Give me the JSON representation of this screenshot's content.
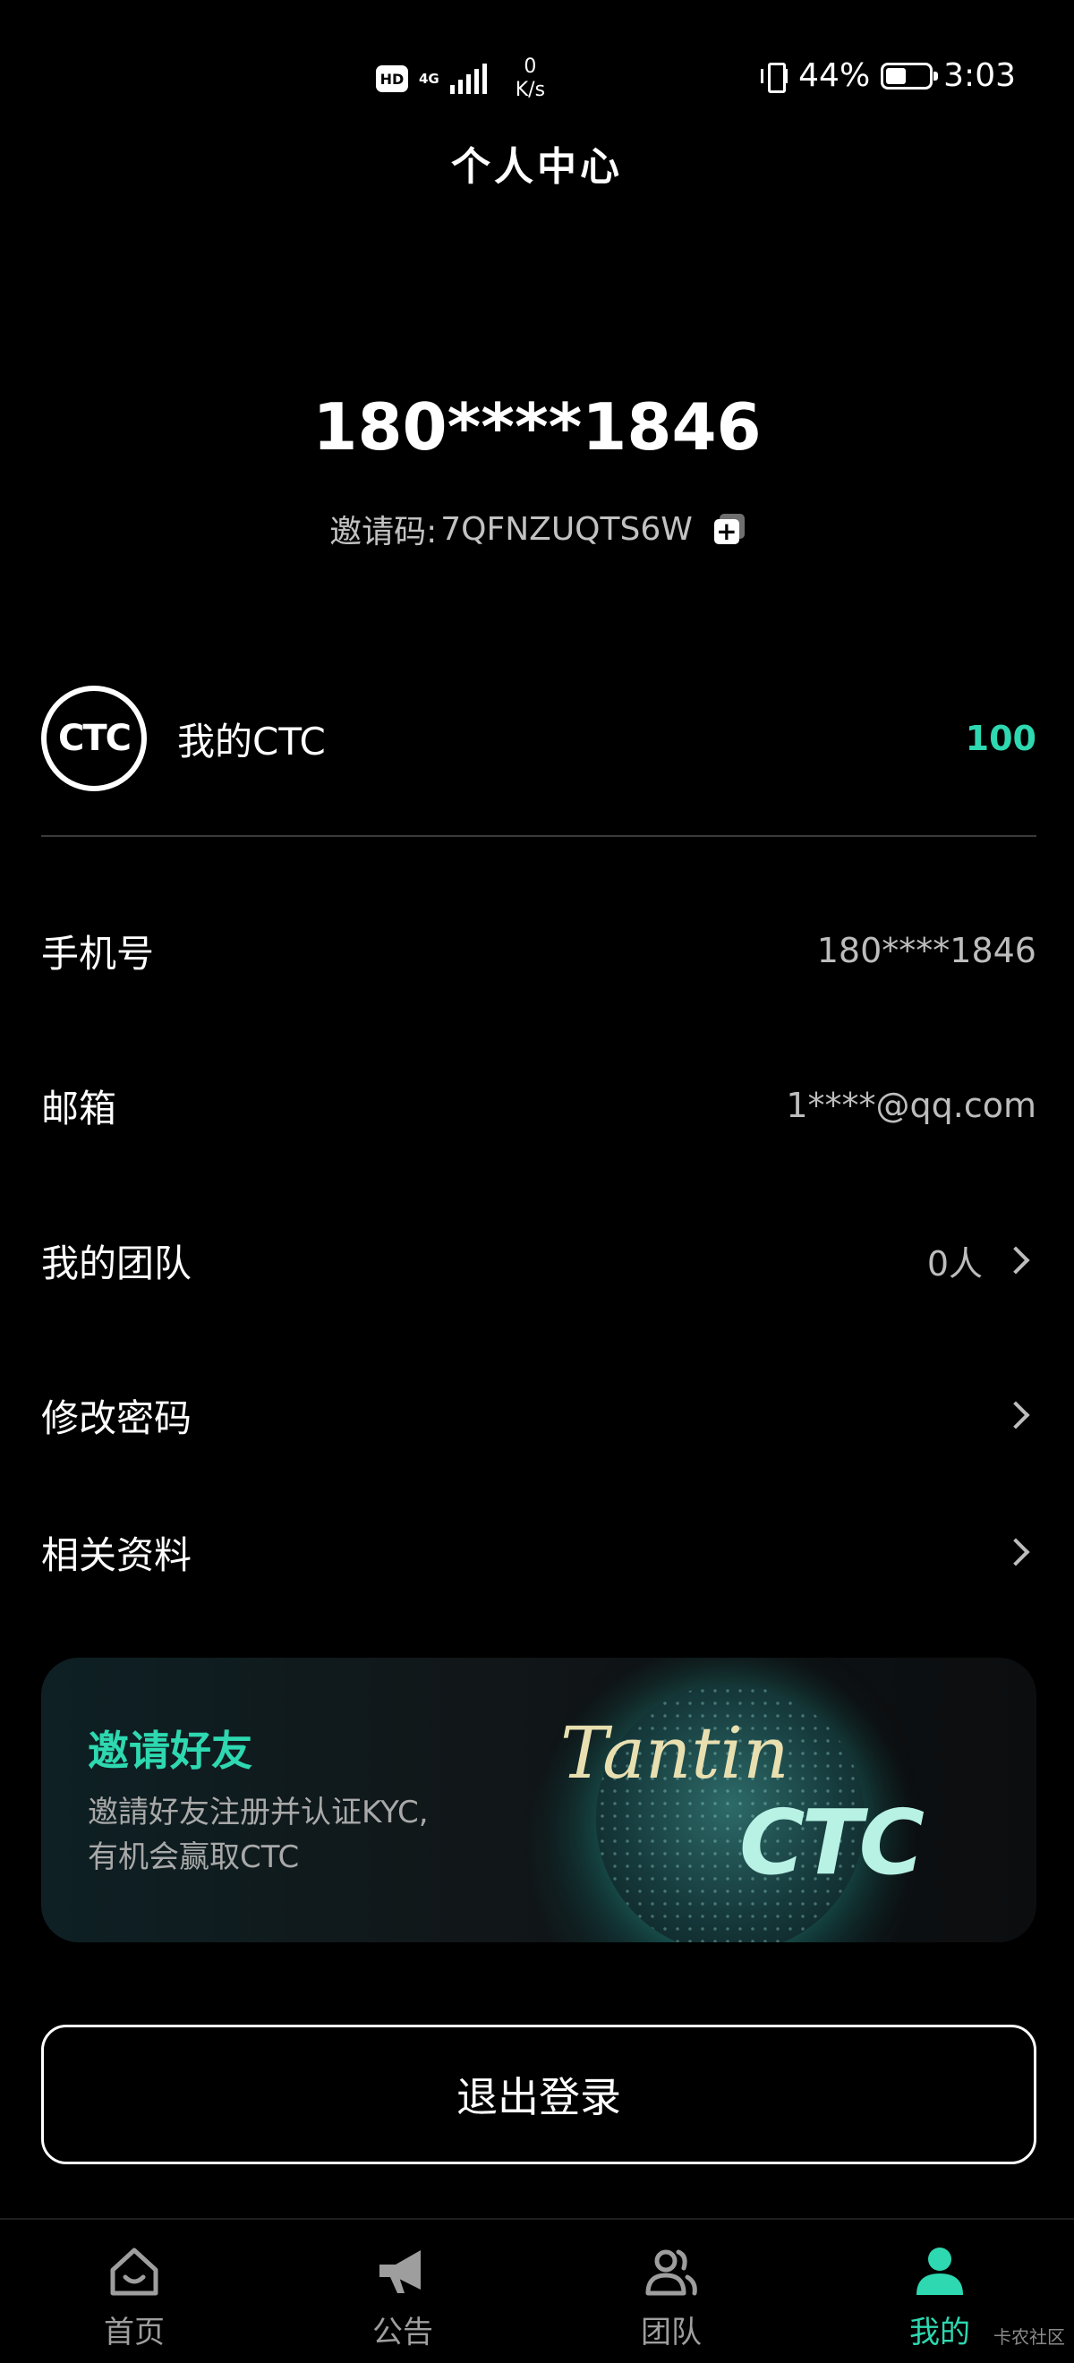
{
  "status_bar": {
    "hd": "HD",
    "network": "4G",
    "speed_value": "0",
    "speed_unit": "K/s",
    "battery": "44%",
    "time": "3:03"
  },
  "header": {
    "title": "个人中心"
  },
  "profile": {
    "phone": "180****1846",
    "invite_label": "邀请码:",
    "invite_code": "7QFNZUQTS6W"
  },
  "ctc": {
    "logo_text": "CTC",
    "label": "我的CTC",
    "value": "100"
  },
  "info_rows": [
    {
      "label": "手机号",
      "value": "180****1846"
    },
    {
      "label": "邮箱",
      "value": "1****@qq.com"
    },
    {
      "label": "我的团队",
      "value": "0人"
    },
    {
      "label": "修改密码"
    },
    {
      "label": "相关资料"
    }
  ],
  "banner": {
    "title": "邀请好友",
    "desc_line1": "邀請好友注册并认证KYC,",
    "desc_line2": "有机会赢取CTC",
    "brand_top": "Tantin",
    "brand_ctc": "CTC"
  },
  "logout": {
    "label": "退出登录"
  },
  "tabs": [
    {
      "label": "首页",
      "icon": "home-icon"
    },
    {
      "label": "公告",
      "icon": "megaphone-icon"
    },
    {
      "label": "团队",
      "icon": "team-icon"
    },
    {
      "label": "我的",
      "icon": "user-icon"
    }
  ],
  "colors": {
    "accent": "#2ed8b0",
    "background": "#000000"
  },
  "watermark": "卡农社区"
}
